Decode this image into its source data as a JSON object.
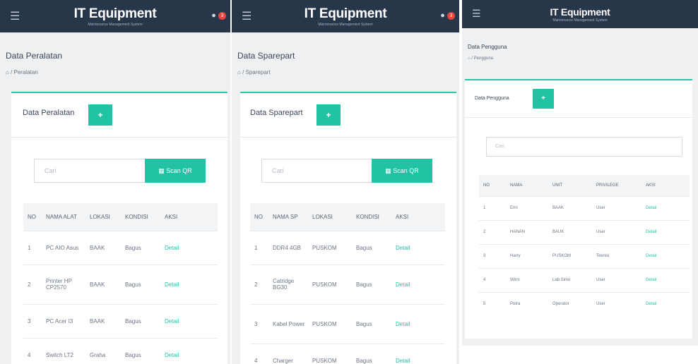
{
  "app": {
    "brand_title": "IT Equipment",
    "brand_subtitle": "Maintenance Management System",
    "notification_count": "3",
    "accent_color": "#22c2a5",
    "topbar_color": "#28364a"
  },
  "screens": [
    {
      "page_title": "Data Peralatan",
      "breadcrumb": "Peralatan",
      "card_title": "Data Peralatan",
      "add_label": "+",
      "search_placeholder": "Cari",
      "scan_label": "Scan QR",
      "columns": [
        "NO",
        "NAMA ALAT",
        "LOKASI",
        "KONDISI",
        "AKSI"
      ],
      "rows": [
        [
          "1",
          "PC AIO Asus",
          "BAAK",
          "Bagus",
          "Detail"
        ],
        [
          "2",
          "Printer HP CP2570",
          "BAAK",
          "Bagus",
          "Detail"
        ],
        [
          "3",
          "PC Acer I3",
          "BAAK",
          "Bagus",
          "Detail"
        ],
        [
          "4",
          "Switch LT2",
          "Graha",
          "Bagus",
          "Detail"
        ]
      ]
    },
    {
      "page_title": "Data Sparepart",
      "breadcrumb": "Sparepart",
      "card_title": "Data Sparepart",
      "add_label": "+",
      "search_placeholder": "Cari",
      "scan_label": "Scan QR",
      "columns": [
        "NO",
        "NAMA SP",
        "LOKASI",
        "KONDISI",
        "AKSI"
      ],
      "rows": [
        [
          "1",
          "DDR4 4GB",
          "PUSKOM",
          "Bagus",
          "Detail"
        ],
        [
          "2",
          "Catridge BG30",
          "PUSKOM",
          "Bagus",
          "Detail"
        ],
        [
          "3",
          "Kabel Power",
          "PUSKOM",
          "Bagus",
          "Detail"
        ],
        [
          "4",
          "Charger",
          "PUSKOM",
          "Bagus",
          "Detail"
        ]
      ]
    },
    {
      "page_title": "Data Pengguna",
      "breadcrumb": "Pengguna",
      "card_title": "Data Pengguna",
      "add_label": "+",
      "search_placeholder": "Cari",
      "columns": [
        "NO",
        "NAMA",
        "UNIT",
        "PRIVILEGE",
        "AKSI"
      ],
      "rows": [
        [
          "1",
          "Erni",
          "BAAK",
          "User",
          "Detail"
        ],
        [
          "2",
          "HANAN",
          "BAUK",
          "User",
          "Detail"
        ],
        [
          "3",
          "Harry",
          "PUSKOM",
          "Teknisi",
          "Detail"
        ],
        [
          "4",
          "Wirni",
          "Lab Simo",
          "User",
          "Detail"
        ],
        [
          "5",
          "Putra",
          "Operator",
          "User",
          "Detail"
        ]
      ]
    }
  ]
}
